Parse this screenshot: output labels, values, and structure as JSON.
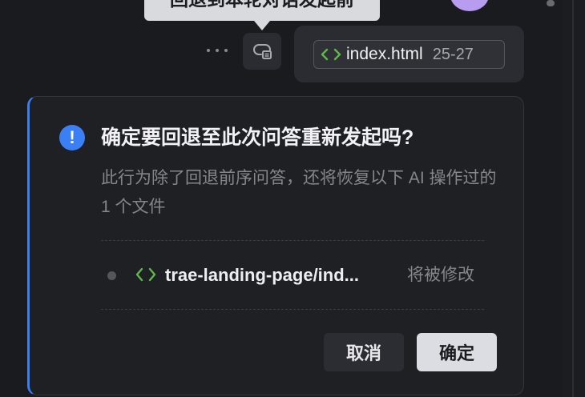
{
  "tooltip": {
    "text": "回退到本轮对话发起前"
  },
  "message": {
    "file_chip": {
      "name": "index.html",
      "range": "25-27",
      "icon": "code-brackets-icon"
    }
  },
  "actions": {
    "more_icon": "ellipsis-icon",
    "rollback_icon": "rollback-icon"
  },
  "dialog": {
    "title": "确定要回退至此次问答重新发起吗?",
    "description": "此行为除了回退前序问答，还将恢复以下 AI 操作过的 1 个文件",
    "icon": "exclamation-icon",
    "files": [
      {
        "name": "trae-landing-page/ind...",
        "status": "将被修改",
        "icon": "code-brackets-icon"
      }
    ],
    "cancel_label": "取消",
    "confirm_label": "确定"
  },
  "colors": {
    "accent": "#3b7ff5",
    "code_icon": "#5fb84a",
    "avatar": "#b79cf0"
  }
}
